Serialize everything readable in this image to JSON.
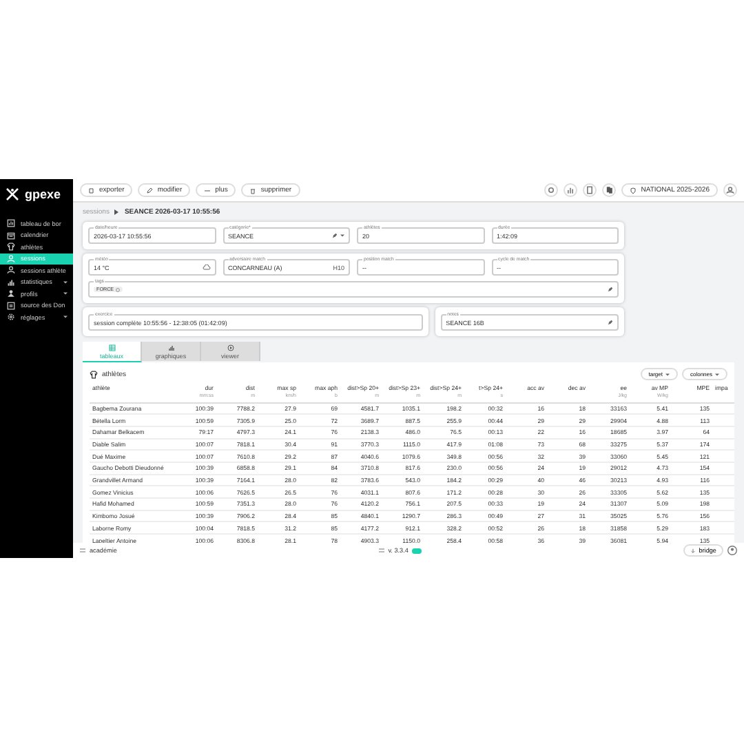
{
  "app": {
    "logo": "gpexe"
  },
  "sidebar": {
    "items": [
      {
        "label": "tableau de bor",
        "selected": false,
        "expandable": false,
        "kind": "dashboard"
      },
      {
        "label": "calendrier",
        "selected": false,
        "expandable": false,
        "kind": "calendar"
      },
      {
        "label": "athlètes",
        "selected": false,
        "expandable": false,
        "kind": "shirt"
      },
      {
        "label": "sessions",
        "selected": true,
        "expandable": false,
        "kind": "people"
      },
      {
        "label": "sessions athlète",
        "selected": false,
        "expandable": false,
        "kind": "people"
      },
      {
        "label": "statistiques",
        "selected": false,
        "expandable": true,
        "kind": "chart"
      },
      {
        "label": "profils",
        "selected": false,
        "expandable": true,
        "kind": "person"
      },
      {
        "label": "source des Don",
        "selected": false,
        "expandable": false,
        "kind": "list"
      },
      {
        "label": "réglages",
        "selected": false,
        "expandable": true,
        "kind": "gear"
      }
    ]
  },
  "toolbar": {
    "buttons": [
      "exporter",
      "modifier",
      "plus",
      "supprimer"
    ],
    "season": "NATIONAL 2025-2026"
  },
  "breadcrumb": {
    "parent": "sessions",
    "current": "SEANCE 2026-03-17 10:55:56"
  },
  "form": {
    "cards": [
      [
        [
          {
            "label": "date/heure",
            "value": "2026-03-17 10:55:56",
            "kind": "text"
          },
          {
            "label": "catégorie*",
            "value": "SEANCE",
            "kind": "select"
          },
          {
            "label": "athlètes",
            "value": "20",
            "kind": "text"
          },
          {
            "label": "durée",
            "value": "1:42:09",
            "kind": "text"
          }
        ]
      ],
      [
        [
          {
            "label": "météo",
            "value": "14 °C",
            "kind": "weather"
          },
          {
            "label": "adversaire match",
            "value": "CONCARNEAU (A)",
            "suffix": "H10",
            "kind": "text"
          },
          {
            "label": "position match",
            "value": "--",
            "kind": "text"
          },
          {
            "label": "cycle de match",
            "value": "--",
            "kind": "text"
          }
        ],
        [
          {
            "label": "tags",
            "value": "FORCE",
            "kind": "tags"
          }
        ]
      ]
    ],
    "exercise": {
      "label": "exercice",
      "value": "session complète 10:55:56 - 12:38:05 (01:42:09)"
    },
    "notes": {
      "label": "notes",
      "value": "SEANCE 16B"
    }
  },
  "tabs": [
    {
      "label": "tableaux",
      "selected": true,
      "kind": "table"
    },
    {
      "label": "graphiques",
      "selected": false,
      "kind": "chart"
    },
    {
      "label": "viewer",
      "selected": false,
      "kind": "play"
    }
  ],
  "table": {
    "title": "athlètes",
    "controls": [
      "target",
      "colonnes"
    ],
    "columns": [
      {
        "label": "athlète"
      },
      {
        "label": "dur",
        "unit": "mm:ss"
      },
      {
        "label": "dist",
        "unit": "m"
      },
      {
        "label": "max sp",
        "unit": "km/h"
      },
      {
        "label": "max aph",
        "unit": "b"
      },
      {
        "label": "dist>Sp 20+",
        "unit": "m"
      },
      {
        "label": "dist>Sp 23+",
        "unit": "m"
      },
      {
        "label": "dist>Sp 24+",
        "unit": "m"
      },
      {
        "label": "t>Sp 24+",
        "unit": "s"
      },
      {
        "label": "acc av"
      },
      {
        "label": "dec av"
      },
      {
        "label": "ee",
        "unit": "J/kg"
      },
      {
        "label": "av MP",
        "unit": "W/kg"
      },
      {
        "label": "MPE"
      },
      {
        "label": "impa"
      }
    ],
    "rows": [
      [
        "Bagbema Zourana",
        "100:39",
        "7788.2",
        "27.9",
        "69",
        "4581.7",
        "1035.1",
        "198.2",
        "00:32",
        "16",
        "18",
        "33163",
        "5.41",
        "135"
      ],
      [
        "Bétella Lorm",
        "100:59",
        "7305.9",
        "25.0",
        "72",
        "3689.7",
        "887.5",
        "255.9",
        "00:44",
        "29",
        "29",
        "29904",
        "4.88",
        "113"
      ],
      [
        "Dahamar Belkacem",
        "79:17",
        "4797.3",
        "24.1",
        "76",
        "2138.3",
        "486.0",
        "76.5",
        "00:13",
        "22",
        "16",
        "18685",
        "3.97",
        "64"
      ],
      [
        "Diable Salim",
        "100:07",
        "7818.1",
        "30.4",
        "91",
        "3770.3",
        "1115.0",
        "417.9",
        "01:08",
        "73",
        "68",
        "33275",
        "5.37",
        "174"
      ],
      [
        "Dué Maxime",
        "100:07",
        "7610.8",
        "29.2",
        "87",
        "4040.6",
        "1079.6",
        "349.8",
        "00:56",
        "32",
        "39",
        "33060",
        "5.45",
        "121"
      ],
      [
        "Gaucho Debotti Dieudonné",
        "100:39",
        "6858.8",
        "29.1",
        "84",
        "3710.8",
        "817.6",
        "230.0",
        "00:56",
        "24",
        "19",
        "29012",
        "4.73",
        "154"
      ],
      [
        "Grandvillet Armand",
        "100:39",
        "7164.1",
        "28.0",
        "82",
        "3783.6",
        "543.0",
        "184.2",
        "00:29",
        "40",
        "46",
        "30213",
        "4.93",
        "116"
      ],
      [
        "Gomez Vinicius",
        "100:06",
        "7626.5",
        "26.5",
        "76",
        "4031.1",
        "807.6",
        "171.2",
        "00:28",
        "30",
        "26",
        "33305",
        "5.62",
        "135"
      ],
      [
        "Hafid Mohamed",
        "100:59",
        "7351.3",
        "28.0",
        "76",
        "4120.2",
        "756.1",
        "207.5",
        "00:33",
        "19",
        "24",
        "31307",
        "5.09",
        "198"
      ],
      [
        "Kimbomo Josué",
        "100:39",
        "7906.2",
        "28.4",
        "85",
        "4840.1",
        "1290.7",
        "286.3",
        "00:49",
        "27",
        "31",
        "35025",
        "5.76",
        "156"
      ],
      [
        "Laborne Romy",
        "100:04",
        "7818.5",
        "31.2",
        "85",
        "4177.2",
        "912.1",
        "328.2",
        "00:52",
        "26",
        "18",
        "31858",
        "5.29",
        "183"
      ],
      [
        "Lapeltier Antoine",
        "100:06",
        "8306.8",
        "28.1",
        "78",
        "4903.3",
        "1150.0",
        "258.4",
        "00:58",
        "36",
        "39",
        "36081",
        "5.94",
        "135"
      ]
    ]
  },
  "footer": {
    "left": "académie",
    "version": "v. 3.3.4",
    "button": "bridge"
  }
}
